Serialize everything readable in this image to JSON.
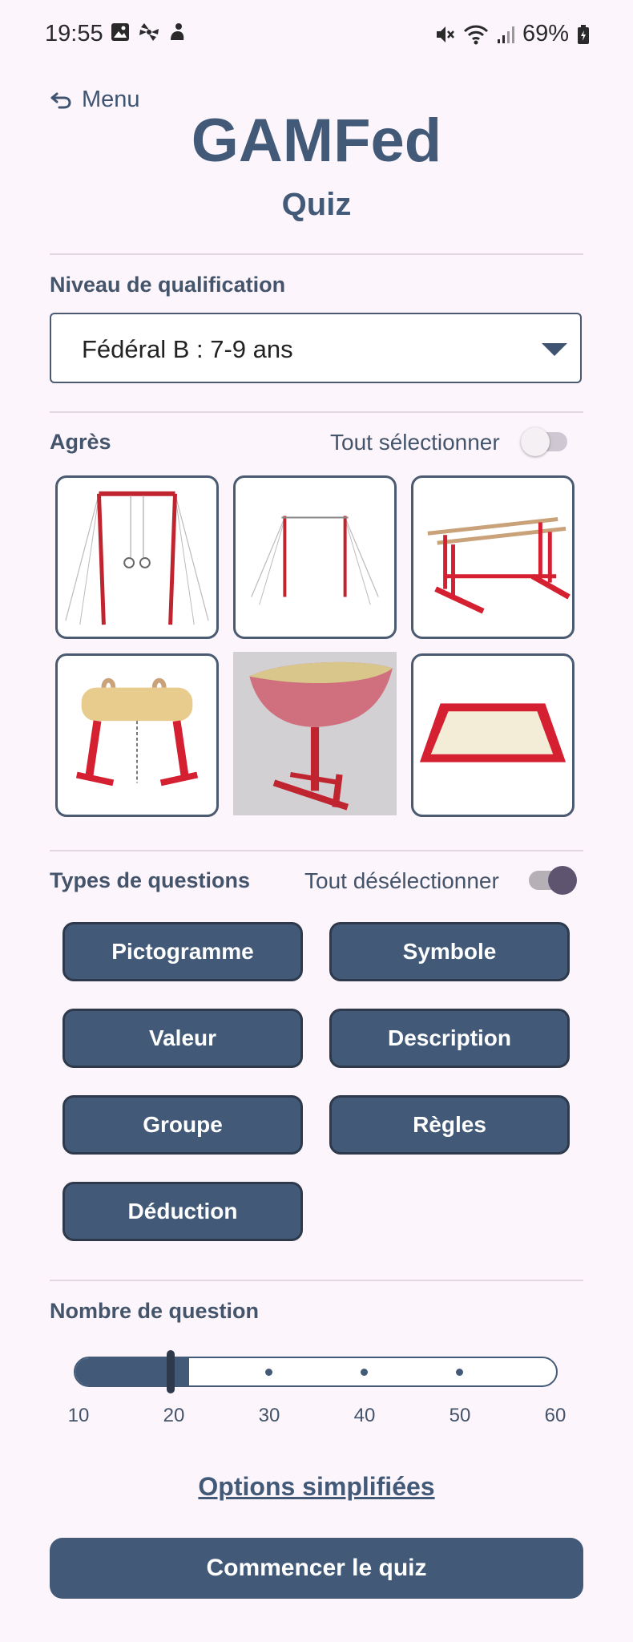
{
  "status_bar": {
    "time": "19:55",
    "battery": "69%",
    "icons_left": [
      "gallery-icon",
      "pinwheel-icon",
      "person-icon"
    ],
    "icons_right": [
      "mute-icon",
      "wifi-icon",
      "signal-icon",
      "battery-icon"
    ]
  },
  "header": {
    "back_label": "Menu",
    "title": "GAMFed",
    "subtitle": "Quiz"
  },
  "qualification": {
    "label": "Niveau de qualification",
    "selected": "Fédéral B : 7-9 ans"
  },
  "apparatus": {
    "label": "Agrès",
    "toggle_label": "Tout sélectionner",
    "toggle_on": false,
    "items": [
      {
        "name": "rings",
        "selected": false
      },
      {
        "name": "high-bar",
        "selected": false
      },
      {
        "name": "parallel-bars",
        "selected": false
      },
      {
        "name": "pommel-horse",
        "selected": false
      },
      {
        "name": "vault",
        "selected": true
      },
      {
        "name": "floor",
        "selected": false
      }
    ]
  },
  "question_types": {
    "label": "Types de questions",
    "toggle_label": "Tout désélectionner",
    "toggle_on": true,
    "buttons": [
      "Pictogramme",
      "Symbole",
      "Valeur",
      "Description",
      "Groupe",
      "Règles",
      "Déduction"
    ]
  },
  "question_count": {
    "label": "Nombre de question",
    "value": 20,
    "min": 10,
    "max": 60,
    "ticks": [
      "10",
      "20",
      "30",
      "40",
      "50",
      "60"
    ]
  },
  "simplified_link": "Options simplifiées",
  "start_button": "Commencer le quiz",
  "colors": {
    "primary": "#425a78",
    "background": "#fcf5fc",
    "apparatus_red": "#d42030"
  }
}
